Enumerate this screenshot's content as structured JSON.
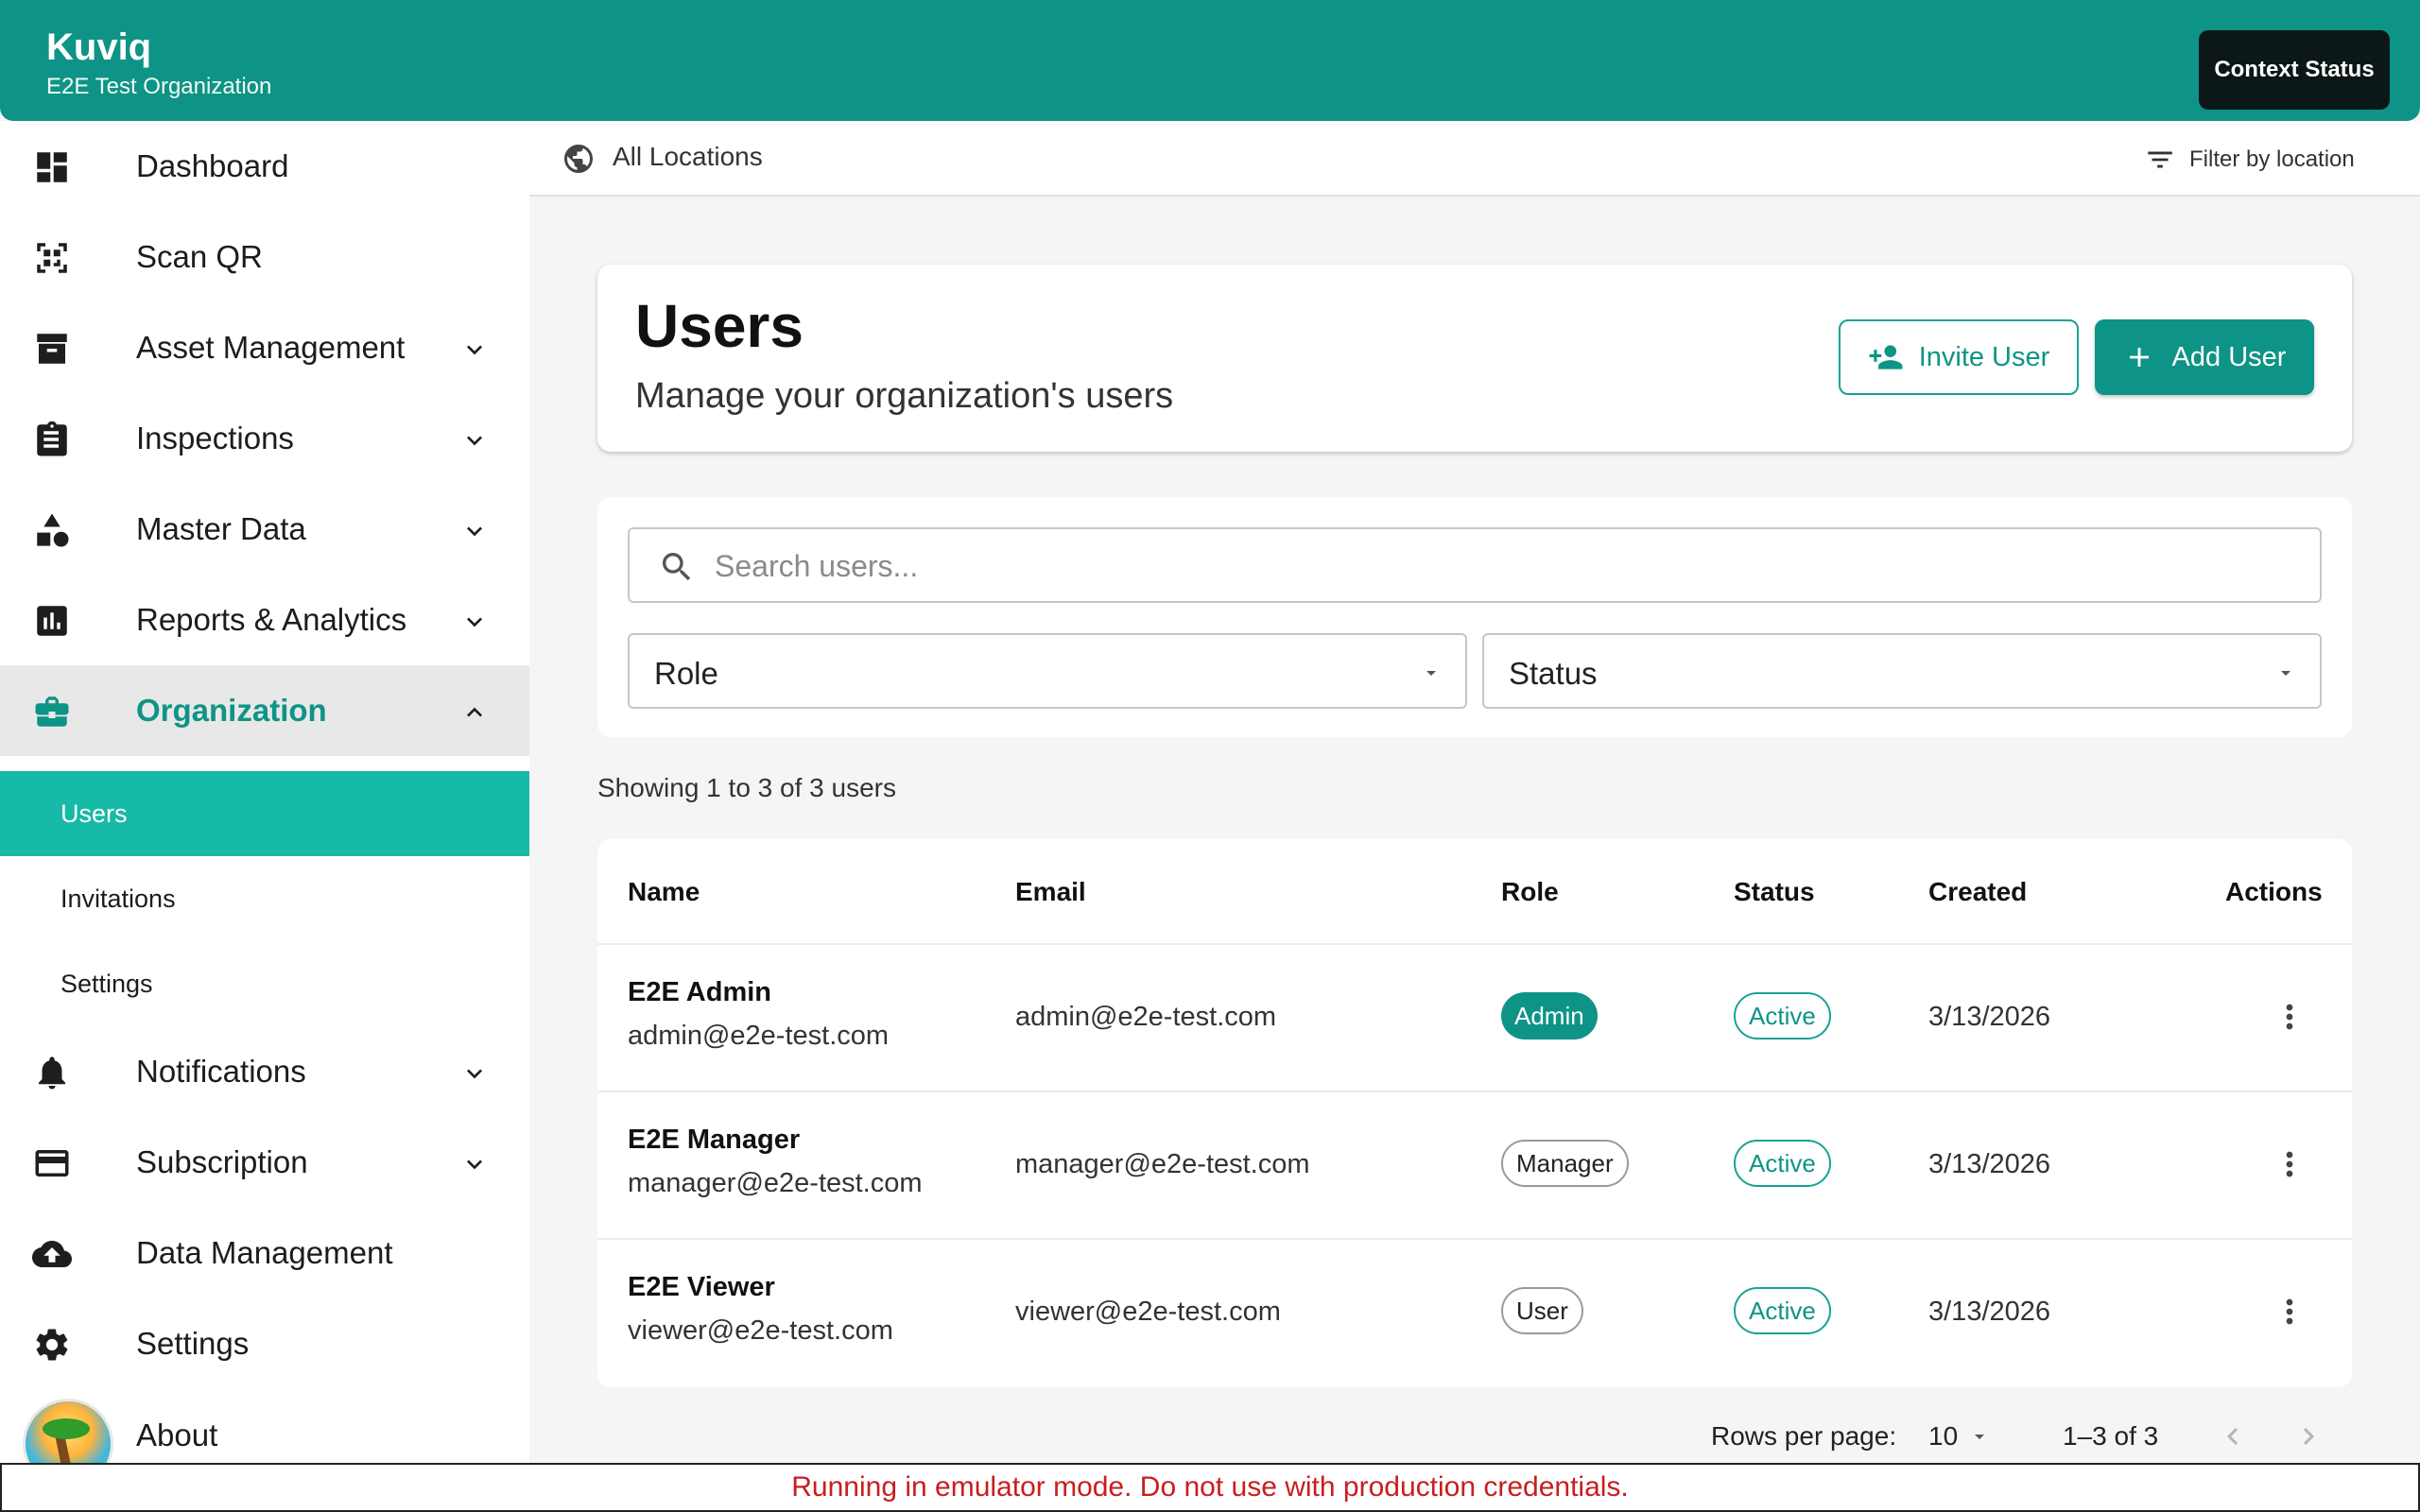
{
  "app": {
    "name": "Kuviq",
    "organization": "E2E Test Organization",
    "context_status_label": "Context Status",
    "accent_color": "#0e9486"
  },
  "sidebar": {
    "items": [
      {
        "label": "Dashboard",
        "icon": "dashboard-icon",
        "expandable": false
      },
      {
        "label": "Scan QR",
        "icon": "qr-scan-icon",
        "expandable": false
      },
      {
        "label": "Asset Management",
        "icon": "archive-box-icon",
        "expandable": true
      },
      {
        "label": "Inspections",
        "icon": "clipboard-icon",
        "expandable": true
      },
      {
        "label": "Master Data",
        "icon": "shapes-icon",
        "expandable": true
      },
      {
        "label": "Reports & Analytics",
        "icon": "bar-chart-icon",
        "expandable": true
      },
      {
        "label": "Organization",
        "icon": "briefcase-icon",
        "expandable": true,
        "expanded": true,
        "active": true
      },
      {
        "label": "Notifications",
        "icon": "bell-icon",
        "expandable": true
      },
      {
        "label": "Subscription",
        "icon": "credit-card-icon",
        "expandable": true
      },
      {
        "label": "Data Management",
        "icon": "cloud-upload-icon",
        "expandable": false
      },
      {
        "label": "Settings",
        "icon": "gear-icon",
        "expandable": false
      },
      {
        "label": "About",
        "icon": "beach-avatar-icon",
        "expandable": false
      }
    ],
    "org_subitems": [
      {
        "label": "Users",
        "selected": true
      },
      {
        "label": "Invitations",
        "selected": false
      },
      {
        "label": "Settings",
        "selected": false
      }
    ]
  },
  "location_bar": {
    "current": "All Locations",
    "filter_label": "Filter by location"
  },
  "page": {
    "title": "Users",
    "subtitle": "Manage your organization's users",
    "invite_label": "Invite User",
    "add_label": "Add User"
  },
  "filters": {
    "search_placeholder": "Search users...",
    "role_label": "Role",
    "status_label": "Status"
  },
  "showing_text": "Showing 1 to 3 of 3 users",
  "table": {
    "headers": {
      "name": "Name",
      "email": "Email",
      "role": "Role",
      "status": "Status",
      "created": "Created",
      "actions": "Actions"
    },
    "rows": [
      {
        "name": "E2E Admin",
        "sub_email": "admin@e2e-test.com",
        "email": "admin@e2e-test.com",
        "role": "Admin",
        "status": "Active",
        "created": "3/13/2026"
      },
      {
        "name": "E2E Manager",
        "sub_email": "manager@e2e-test.com",
        "email": "manager@e2e-test.com",
        "role": "Manager",
        "status": "Active",
        "created": "3/13/2026"
      },
      {
        "name": "E2E Viewer",
        "sub_email": "viewer@e2e-test.com",
        "email": "viewer@e2e-test.com",
        "role": "User",
        "status": "Active",
        "created": "3/13/2026"
      }
    ]
  },
  "pagination": {
    "rows_per_page_label": "Rows per page:",
    "rows_per_page": "10",
    "range": "1–3 of 3"
  },
  "footer_banner": "Running in emulator mode. Do not use with production credentials."
}
